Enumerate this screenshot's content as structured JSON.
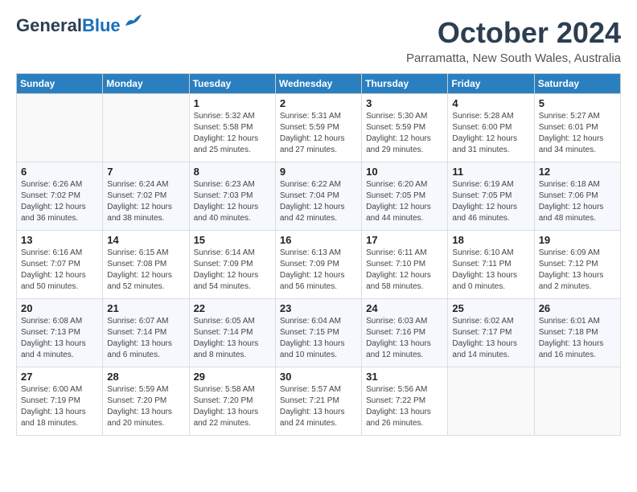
{
  "header": {
    "logo_line1": "General",
    "logo_line2": "Blue",
    "month": "October 2024",
    "location": "Parramatta, New South Wales, Australia"
  },
  "days_of_week": [
    "Sunday",
    "Monday",
    "Tuesday",
    "Wednesday",
    "Thursday",
    "Friday",
    "Saturday"
  ],
  "weeks": [
    [
      {
        "day": "",
        "info": ""
      },
      {
        "day": "",
        "info": ""
      },
      {
        "day": "1",
        "info": "Sunrise: 5:32 AM\nSunset: 5:58 PM\nDaylight: 12 hours\nand 25 minutes."
      },
      {
        "day": "2",
        "info": "Sunrise: 5:31 AM\nSunset: 5:59 PM\nDaylight: 12 hours\nand 27 minutes."
      },
      {
        "day": "3",
        "info": "Sunrise: 5:30 AM\nSunset: 5:59 PM\nDaylight: 12 hours\nand 29 minutes."
      },
      {
        "day": "4",
        "info": "Sunrise: 5:28 AM\nSunset: 6:00 PM\nDaylight: 12 hours\nand 31 minutes."
      },
      {
        "day": "5",
        "info": "Sunrise: 5:27 AM\nSunset: 6:01 PM\nDaylight: 12 hours\nand 34 minutes."
      }
    ],
    [
      {
        "day": "6",
        "info": "Sunrise: 6:26 AM\nSunset: 7:02 PM\nDaylight: 12 hours\nand 36 minutes."
      },
      {
        "day": "7",
        "info": "Sunrise: 6:24 AM\nSunset: 7:02 PM\nDaylight: 12 hours\nand 38 minutes."
      },
      {
        "day": "8",
        "info": "Sunrise: 6:23 AM\nSunset: 7:03 PM\nDaylight: 12 hours\nand 40 minutes."
      },
      {
        "day": "9",
        "info": "Sunrise: 6:22 AM\nSunset: 7:04 PM\nDaylight: 12 hours\nand 42 minutes."
      },
      {
        "day": "10",
        "info": "Sunrise: 6:20 AM\nSunset: 7:05 PM\nDaylight: 12 hours\nand 44 minutes."
      },
      {
        "day": "11",
        "info": "Sunrise: 6:19 AM\nSunset: 7:05 PM\nDaylight: 12 hours\nand 46 minutes."
      },
      {
        "day": "12",
        "info": "Sunrise: 6:18 AM\nSunset: 7:06 PM\nDaylight: 12 hours\nand 48 minutes."
      }
    ],
    [
      {
        "day": "13",
        "info": "Sunrise: 6:16 AM\nSunset: 7:07 PM\nDaylight: 12 hours\nand 50 minutes."
      },
      {
        "day": "14",
        "info": "Sunrise: 6:15 AM\nSunset: 7:08 PM\nDaylight: 12 hours\nand 52 minutes."
      },
      {
        "day": "15",
        "info": "Sunrise: 6:14 AM\nSunset: 7:09 PM\nDaylight: 12 hours\nand 54 minutes."
      },
      {
        "day": "16",
        "info": "Sunrise: 6:13 AM\nSunset: 7:09 PM\nDaylight: 12 hours\nand 56 minutes."
      },
      {
        "day": "17",
        "info": "Sunrise: 6:11 AM\nSunset: 7:10 PM\nDaylight: 12 hours\nand 58 minutes."
      },
      {
        "day": "18",
        "info": "Sunrise: 6:10 AM\nSunset: 7:11 PM\nDaylight: 13 hours\nand 0 minutes."
      },
      {
        "day": "19",
        "info": "Sunrise: 6:09 AM\nSunset: 7:12 PM\nDaylight: 13 hours\nand 2 minutes."
      }
    ],
    [
      {
        "day": "20",
        "info": "Sunrise: 6:08 AM\nSunset: 7:13 PM\nDaylight: 13 hours\nand 4 minutes."
      },
      {
        "day": "21",
        "info": "Sunrise: 6:07 AM\nSunset: 7:14 PM\nDaylight: 13 hours\nand 6 minutes."
      },
      {
        "day": "22",
        "info": "Sunrise: 6:05 AM\nSunset: 7:14 PM\nDaylight: 13 hours\nand 8 minutes."
      },
      {
        "day": "23",
        "info": "Sunrise: 6:04 AM\nSunset: 7:15 PM\nDaylight: 13 hours\nand 10 minutes."
      },
      {
        "day": "24",
        "info": "Sunrise: 6:03 AM\nSunset: 7:16 PM\nDaylight: 13 hours\nand 12 minutes."
      },
      {
        "day": "25",
        "info": "Sunrise: 6:02 AM\nSunset: 7:17 PM\nDaylight: 13 hours\nand 14 minutes."
      },
      {
        "day": "26",
        "info": "Sunrise: 6:01 AM\nSunset: 7:18 PM\nDaylight: 13 hours\nand 16 minutes."
      }
    ],
    [
      {
        "day": "27",
        "info": "Sunrise: 6:00 AM\nSunset: 7:19 PM\nDaylight: 13 hours\nand 18 minutes."
      },
      {
        "day": "28",
        "info": "Sunrise: 5:59 AM\nSunset: 7:20 PM\nDaylight: 13 hours\nand 20 minutes."
      },
      {
        "day": "29",
        "info": "Sunrise: 5:58 AM\nSunset: 7:20 PM\nDaylight: 13 hours\nand 22 minutes."
      },
      {
        "day": "30",
        "info": "Sunrise: 5:57 AM\nSunset: 7:21 PM\nDaylight: 13 hours\nand 24 minutes."
      },
      {
        "day": "31",
        "info": "Sunrise: 5:56 AM\nSunset: 7:22 PM\nDaylight: 13 hours\nand 26 minutes."
      },
      {
        "day": "",
        "info": ""
      },
      {
        "day": "",
        "info": ""
      }
    ]
  ]
}
